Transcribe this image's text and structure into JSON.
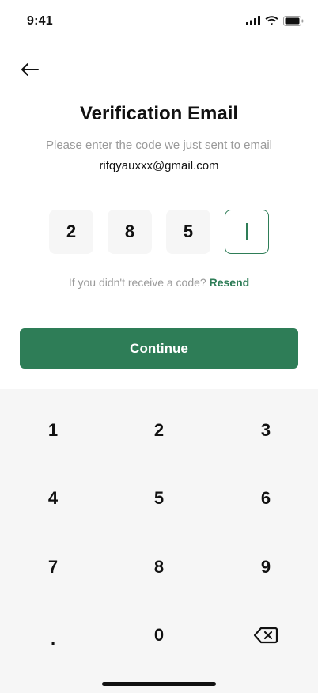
{
  "status_bar": {
    "time": "9:41",
    "icons": [
      "signal-icon",
      "wifi-icon",
      "battery-icon"
    ]
  },
  "nav": {
    "back_icon": "back-arrow-icon"
  },
  "header": {
    "title": "Verification Email",
    "subtitle": "Please enter the code we just sent to email",
    "email": "rifqyauxxx@gmail.com"
  },
  "otp": {
    "digits": [
      "2",
      "8",
      "5",
      ""
    ],
    "active_index": 3
  },
  "resend": {
    "prompt": "If you didn't receive a code? ",
    "link": "Resend"
  },
  "actions": {
    "continue_label": "Continue"
  },
  "keypad": {
    "keys": [
      "1",
      "2",
      "3",
      "4",
      "5",
      "6",
      "7",
      "8",
      "9",
      ".",
      "0"
    ],
    "delete_icon": "backspace-icon"
  },
  "colors": {
    "accent": "#2e7d57",
    "muted_text": "#9a9a9a",
    "keypad_bg": "#f6f6f6"
  }
}
